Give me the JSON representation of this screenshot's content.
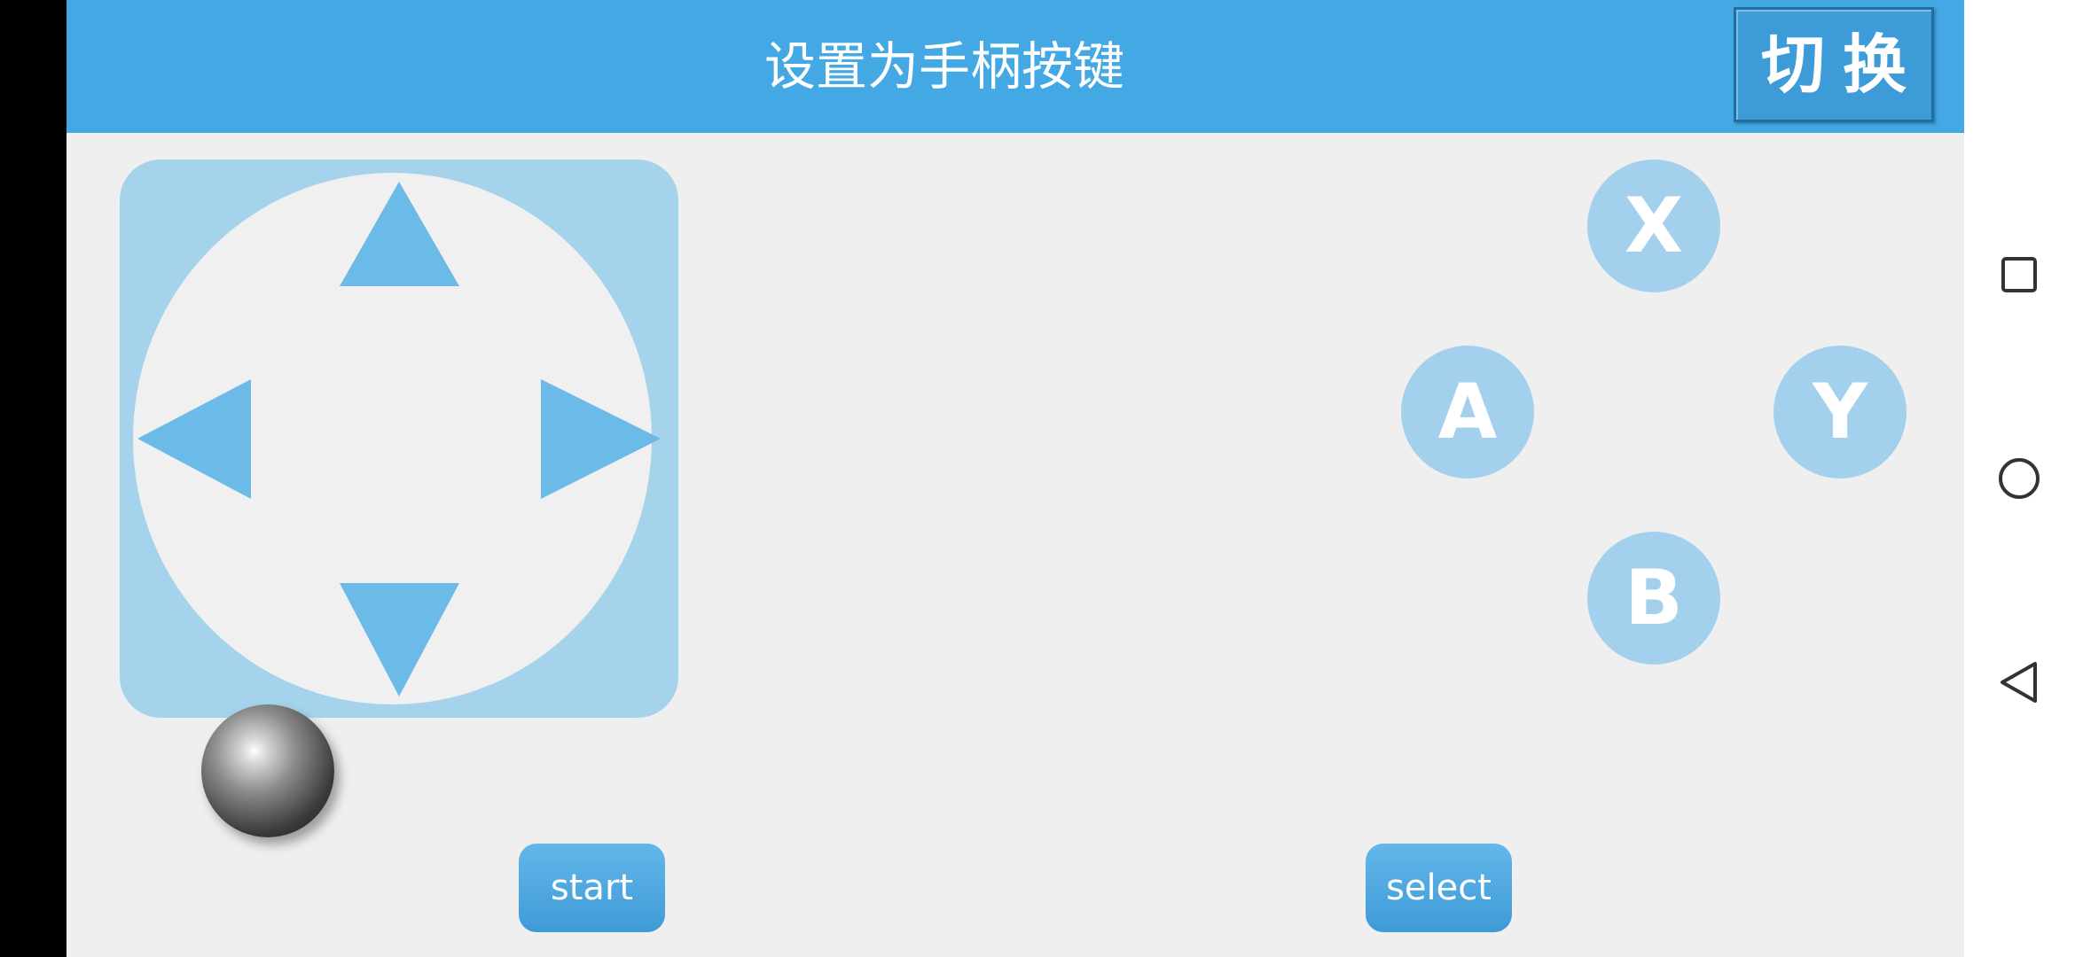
{
  "header": {
    "title": "设置为手柄按键",
    "switch_label": "切换"
  },
  "dpad": {
    "up_icon": "arrow-up-icon",
    "down_icon": "arrow-down-icon",
    "left_icon": "arrow-left-icon",
    "right_icon": "arrow-right-icon"
  },
  "face_buttons": {
    "x": "X",
    "a": "A",
    "y": "Y",
    "b": "B"
  },
  "controls": {
    "start_label": "start",
    "select_label": "select"
  },
  "nav_bar": {
    "recents_icon": "square-icon",
    "home_icon": "circle-icon",
    "back_icon": "triangle-back-icon"
  },
  "colors": {
    "accent": "#43a8e3",
    "dpad_arrow": "#6cbae8",
    "face_button": "#a3d0ec"
  }
}
